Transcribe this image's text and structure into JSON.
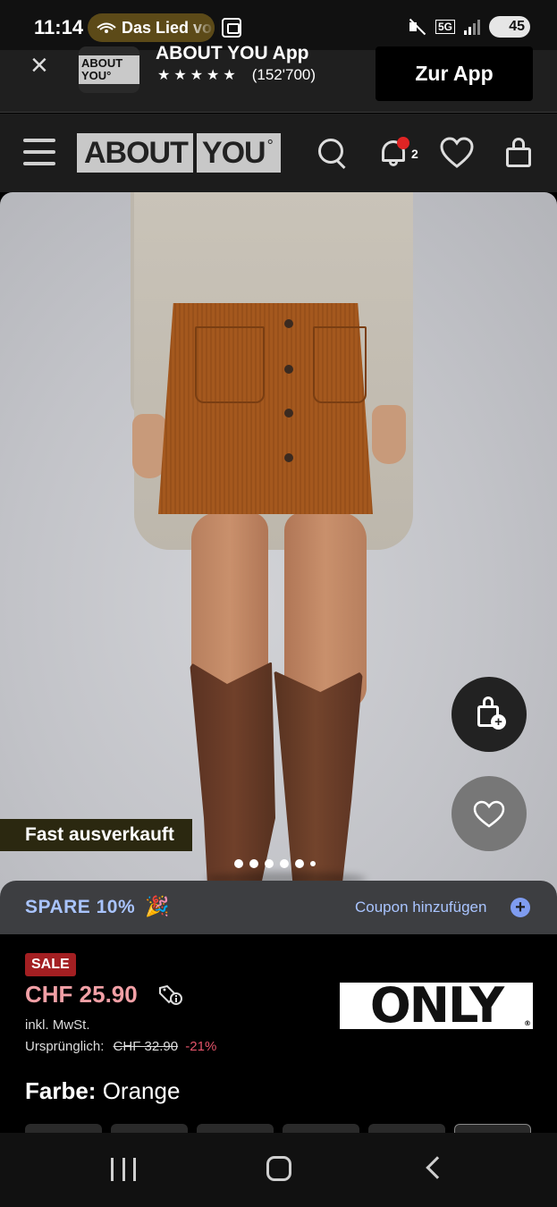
{
  "status_bar": {
    "time": "11:14",
    "media_pill": "Das Lied vo",
    "network": "5G",
    "battery": "45"
  },
  "app_banner": {
    "logo_text": "ABOUT YOU°",
    "title": "ABOUT YOU App",
    "stars": "★★★★★",
    "rating_count": "(152'700)",
    "cta": "Zur App"
  },
  "header": {
    "logo_left": "ABOUT",
    "logo_right": "YOU",
    "logo_mark": "°",
    "notification_count": "2"
  },
  "product": {
    "badge": "Fast ausverkauft",
    "gallery_dots": 6,
    "active_dot": 0
  },
  "coupon": {
    "label": "SPARE 10%",
    "emoji": "🎉",
    "link": "Coupon hinzufügen",
    "plus": "+"
  },
  "price": {
    "sale_badge": "SALE",
    "current": "CHF 25.90",
    "tax_note": "inkl. MwSt.",
    "original_label": "Ursprünglich:",
    "original_price": "CHF 32.90",
    "discount": "-21%",
    "brand": "ONLY",
    "brand_mark": "®"
  },
  "color": {
    "label": "Farbe:",
    "value": "Orange"
  },
  "colors": {
    "price_pink": "#f2a0a6",
    "sale_red": "#a31f22",
    "coupon_blue": "#a9c4ff",
    "skirt": "#a4581e"
  }
}
